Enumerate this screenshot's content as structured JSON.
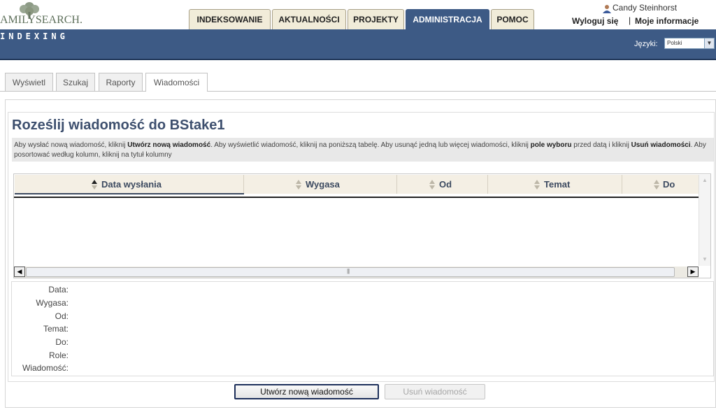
{
  "brand": {
    "logo_text": "AMILYSEARCH.",
    "section": "INDEXING"
  },
  "nav": {
    "tabs": [
      {
        "label": "INDEKSOWANIE"
      },
      {
        "label": "AKTUALNOŚCI"
      },
      {
        "label": "PROJEKTY"
      },
      {
        "label": "ADMINISTRACJA",
        "active": true
      },
      {
        "label": "POMOC"
      }
    ]
  },
  "user": {
    "name": "Candy Steinhorst",
    "logout": "Wyloguj się",
    "separator": "|",
    "my_info": "Moje informacje"
  },
  "language": {
    "label": "Języki:",
    "selected": "Polski"
  },
  "subtabs": [
    {
      "label": "Wyświetl"
    },
    {
      "label": "Szukaj"
    },
    {
      "label": "Raporty"
    },
    {
      "label": "Wiadomości",
      "active": true
    }
  ],
  "page": {
    "title": "Roześlij wiadomość do BStake1",
    "instructions": {
      "p1": "Aby wysłać nową wiadomość, kliknij ",
      "b1": "Utwórz nową wiadomość",
      "p2": ". Aby wyświetlić wiadomość, kliknij na poniższą tabelę. Aby usunąć jedną lub więcej wiadomości, kliknij ",
      "b2": "pole wyboru",
      "p3": " przed datą i kliknij ",
      "b3": "Usuń wiadomości",
      "p4": ". Aby posortować według kolumn, kliknij na tytuł kolumny"
    }
  },
  "grid": {
    "columns": [
      {
        "label": "Data wysłania"
      },
      {
        "label": "Wygasa"
      },
      {
        "label": "Od"
      },
      {
        "label": "Temat"
      },
      {
        "label": "Do"
      }
    ],
    "rows": []
  },
  "detail": {
    "labels": [
      "Data:",
      "Wygasa:",
      "Od:",
      "Temat:",
      "Do:",
      "Role:",
      "Wiadomość:"
    ]
  },
  "buttons": {
    "create": "Utwórz nową wiadomość",
    "delete": "Usuń wiadomość"
  },
  "colors": {
    "header_band": "#3d5a85",
    "tab_bg": "#f1ecd9",
    "title": "#3d4f6e"
  }
}
